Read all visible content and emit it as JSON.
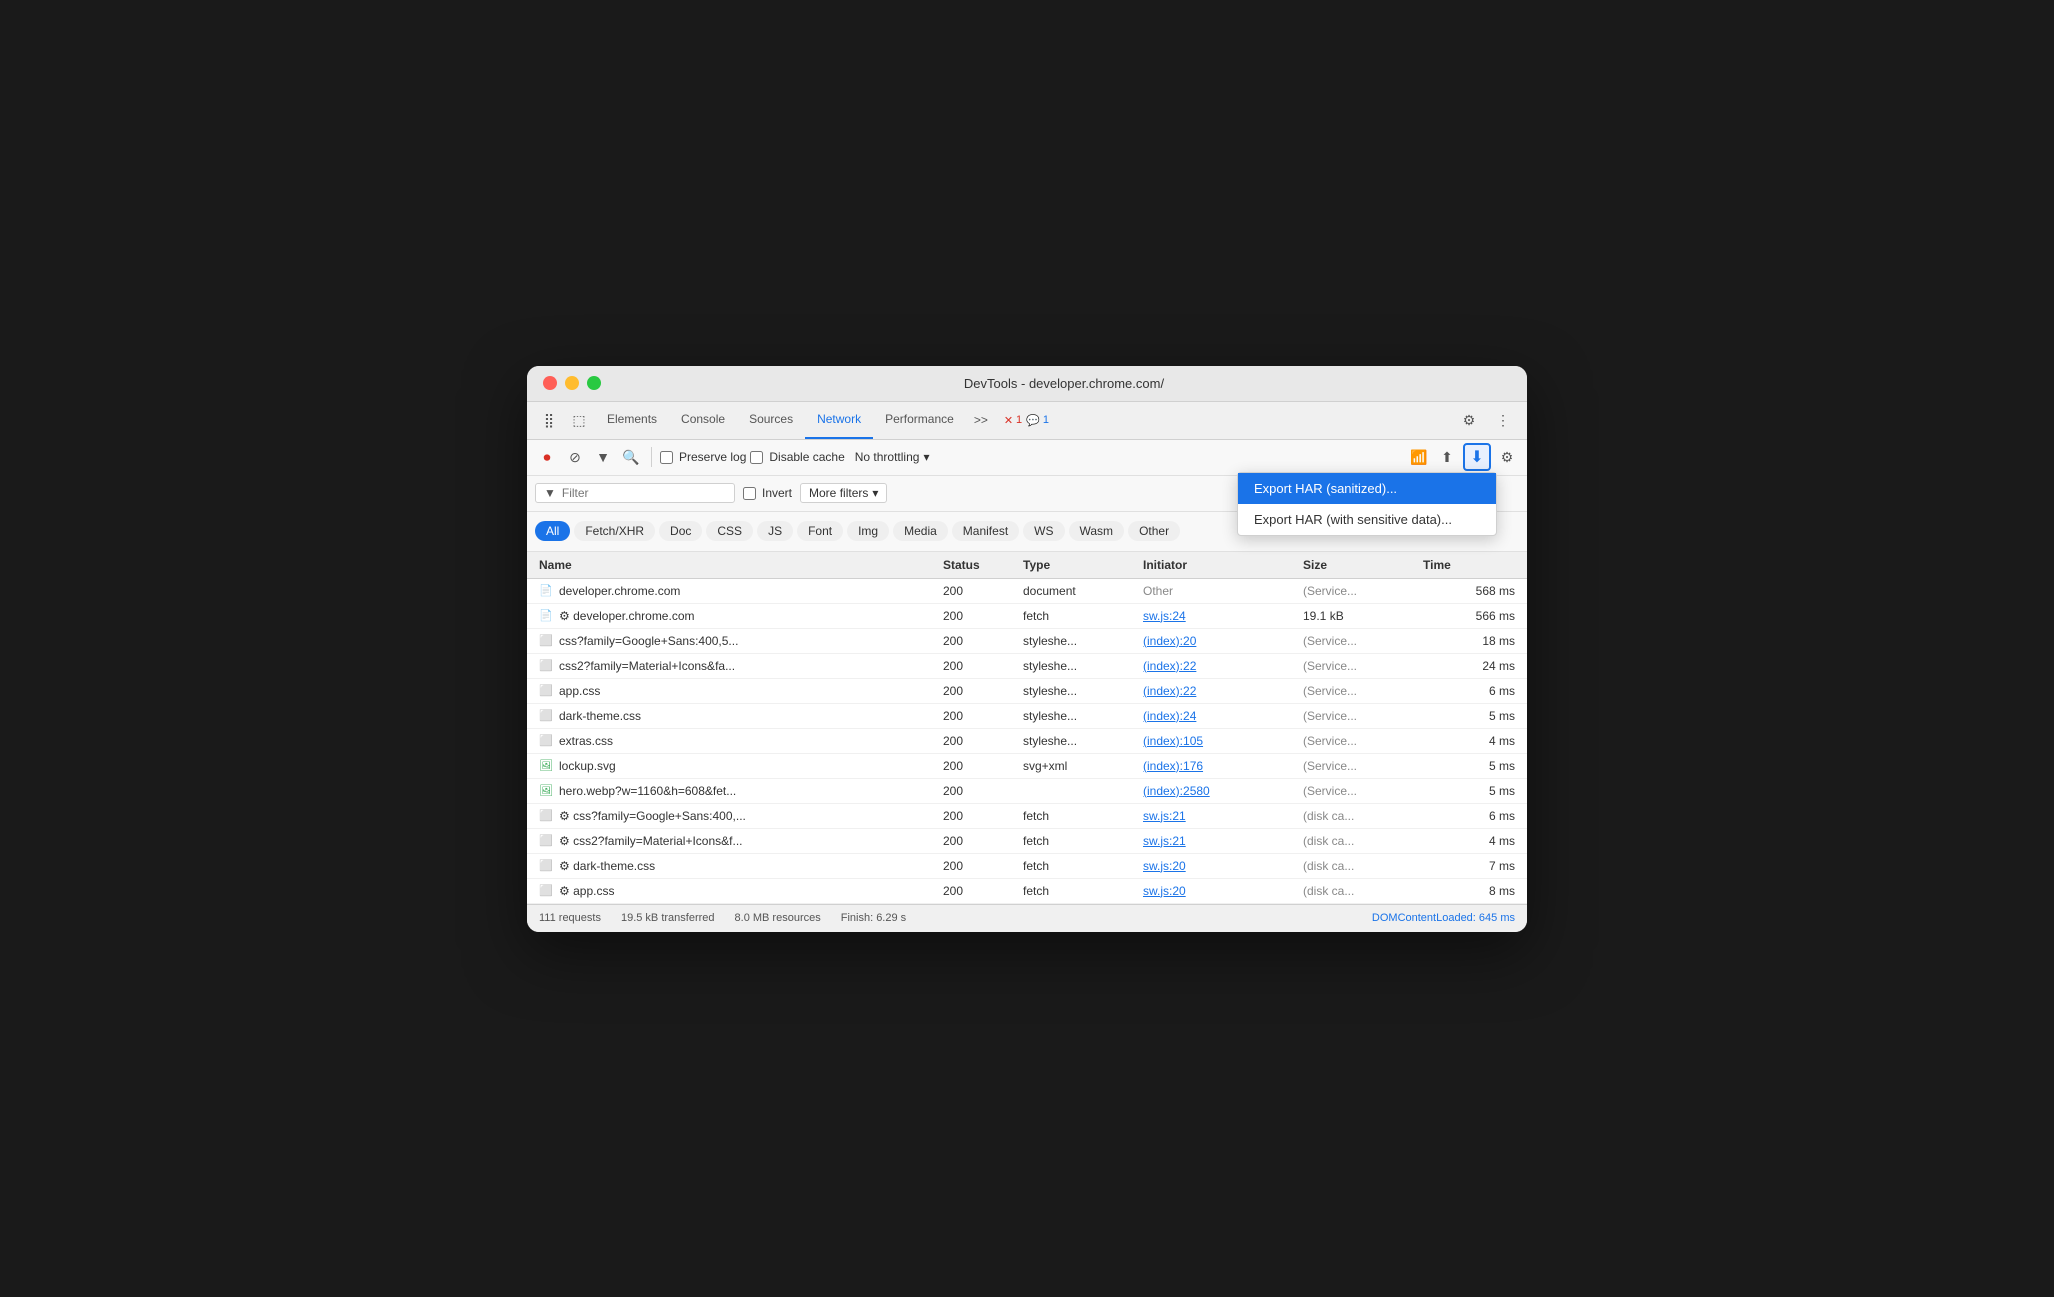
{
  "window": {
    "title": "DevTools - developer.chrome.com/"
  },
  "traffic_lights": {
    "red": "red",
    "yellow": "yellow",
    "green": "green"
  },
  "devtools_tabs": {
    "items": [
      {
        "label": "Elements",
        "active": false
      },
      {
        "label": "Console",
        "active": false
      },
      {
        "label": "Sources",
        "active": false
      },
      {
        "label": "Network",
        "active": true
      },
      {
        "label": "Performance",
        "active": false
      }
    ],
    "more": ">>",
    "error_badge": "1",
    "warn_badge": "1"
  },
  "toolbar": {
    "preserve_log_label": "Preserve log",
    "disable_cache_label": "Disable cache",
    "throttle_label": "No throttling",
    "download_btn_label": "⬇"
  },
  "filter_bar": {
    "filter_placeholder": "Filter",
    "invert_label": "Invert",
    "more_filters_label": "More filters",
    "more_filters_icon": "▾"
  },
  "type_filters": {
    "items": [
      {
        "label": "All",
        "active": true
      },
      {
        "label": "Fetch/XHR",
        "active": false
      },
      {
        "label": "Doc",
        "active": false
      },
      {
        "label": "CSS",
        "active": false
      },
      {
        "label": "JS",
        "active": false
      },
      {
        "label": "Font",
        "active": false
      },
      {
        "label": "Img",
        "active": false
      },
      {
        "label": "Media",
        "active": false
      },
      {
        "label": "Manifest",
        "active": false
      },
      {
        "label": "WS",
        "active": false
      },
      {
        "label": "Wasm",
        "active": false
      },
      {
        "label": "Other",
        "active": false
      }
    ]
  },
  "table": {
    "headers": [
      "Name",
      "Status",
      "Type",
      "Initiator",
      "Size",
      "Time"
    ],
    "rows": [
      {
        "icon": "doc",
        "name": "developer.chrome.com",
        "status": "200",
        "type": "document",
        "initiator": "Other",
        "initiator_link": false,
        "size": "(Service...",
        "time": "568 ms"
      },
      {
        "icon": "doc",
        "name": "⚙ developer.chrome.com",
        "status": "200",
        "type": "fetch",
        "initiator": "sw.js:24",
        "initiator_link": true,
        "size": "19.1 kB",
        "time": "566 ms"
      },
      {
        "icon": "css",
        "name": "css?family=Google+Sans:400,5...",
        "status": "200",
        "type": "styleshe...",
        "initiator": "(index):20",
        "initiator_link": true,
        "size": "(Service...",
        "time": "18 ms"
      },
      {
        "icon": "css",
        "name": "css2?family=Material+Icons&fa...",
        "status": "200",
        "type": "styleshe...",
        "initiator": "(index):22",
        "initiator_link": true,
        "size": "(Service...",
        "time": "24 ms"
      },
      {
        "icon": "css",
        "name": "app.css",
        "status": "200",
        "type": "styleshe...",
        "initiator": "(index):22",
        "initiator_link": true,
        "size": "(Service...",
        "time": "6 ms"
      },
      {
        "icon": "css",
        "name": "dark-theme.css",
        "status": "200",
        "type": "styleshe...",
        "initiator": "(index):24",
        "initiator_link": true,
        "size": "(Service...",
        "time": "5 ms"
      },
      {
        "icon": "css",
        "name": "extras.css",
        "status": "200",
        "type": "styleshe...",
        "initiator": "(index):105",
        "initiator_link": true,
        "size": "(Service...",
        "time": "4 ms"
      },
      {
        "icon": "img",
        "name": "lockup.svg",
        "status": "200",
        "type": "svg+xml",
        "initiator": "(index):176",
        "initiator_link": true,
        "size": "(Service...",
        "time": "5 ms"
      },
      {
        "icon": "img",
        "name": "hero.webp?w=1160&h=608&fet...",
        "status": "200",
        "type": "",
        "initiator": "(index):2580",
        "initiator_link": true,
        "size": "(Service...",
        "time": "5 ms"
      },
      {
        "icon": "css",
        "name": "⚙ css?family=Google+Sans:400,...",
        "status": "200",
        "type": "fetch",
        "initiator": "sw.js:21",
        "initiator_link": true,
        "size": "(disk ca...",
        "time": "6 ms"
      },
      {
        "icon": "css",
        "name": "⚙ css2?family=Material+Icons&f...",
        "status": "200",
        "type": "fetch",
        "initiator": "sw.js:21",
        "initiator_link": true,
        "size": "(disk ca...",
        "time": "4 ms"
      },
      {
        "icon": "css",
        "name": "⚙ dark-theme.css",
        "status": "200",
        "type": "fetch",
        "initiator": "sw.js:20",
        "initiator_link": true,
        "size": "(disk ca...",
        "time": "7 ms"
      },
      {
        "icon": "css",
        "name": "⚙ app.css",
        "status": "200",
        "type": "fetch",
        "initiator": "sw.js:20",
        "initiator_link": true,
        "size": "(disk ca...",
        "time": "8 ms"
      }
    ]
  },
  "dropdown": {
    "items": [
      {
        "label": "Export HAR (sanitized)...",
        "highlighted": true
      },
      {
        "label": "Export HAR (with sensitive data)...",
        "highlighted": false
      }
    ]
  },
  "status_bar": {
    "requests": "111 requests",
    "transferred": "19.5 kB transferred",
    "resources": "8.0 MB resources",
    "finish": "Finish: 6.29 s",
    "domcl": "DOMContentLoaded: 645 ms"
  }
}
